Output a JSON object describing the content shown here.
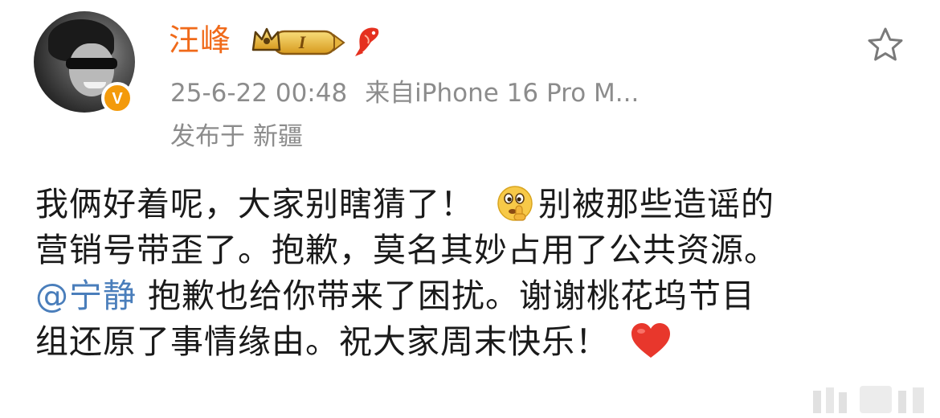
{
  "post": {
    "author": {
      "name": "汪峰",
      "level_badge": "I",
      "verified_mark": "V"
    },
    "meta": {
      "timestamp": "25-6-22 00:48",
      "source": "来自iPhone 16 Pro M..."
    },
    "location": {
      "prefix": "发布于",
      "name": "新疆"
    },
    "content": {
      "line1_a": "我俩好着呢，大家别瞎猜了！",
      "line1_b": "别被那些造谣的",
      "line2": "营销号带歪了。抱歉，莫名其妙占用了公共资源。",
      "mention": "@宁静",
      "line3_rest": " 抱歉也给你带来了困扰。谢谢桃花坞节目",
      "line4": "组还原了事情缘由。祝大家周末快乐！"
    },
    "icons": {
      "favorite": "star-outline-icon",
      "emoji_1": "shushing-face-emoji",
      "emoji_2": "red-heart-emoji"
    },
    "colors": {
      "username": "#f06a1a",
      "meta_text": "#8c8c8c",
      "mention": "#4a7ebb",
      "verified": "#f39a0b",
      "body_text": "#1a1a1a"
    }
  }
}
